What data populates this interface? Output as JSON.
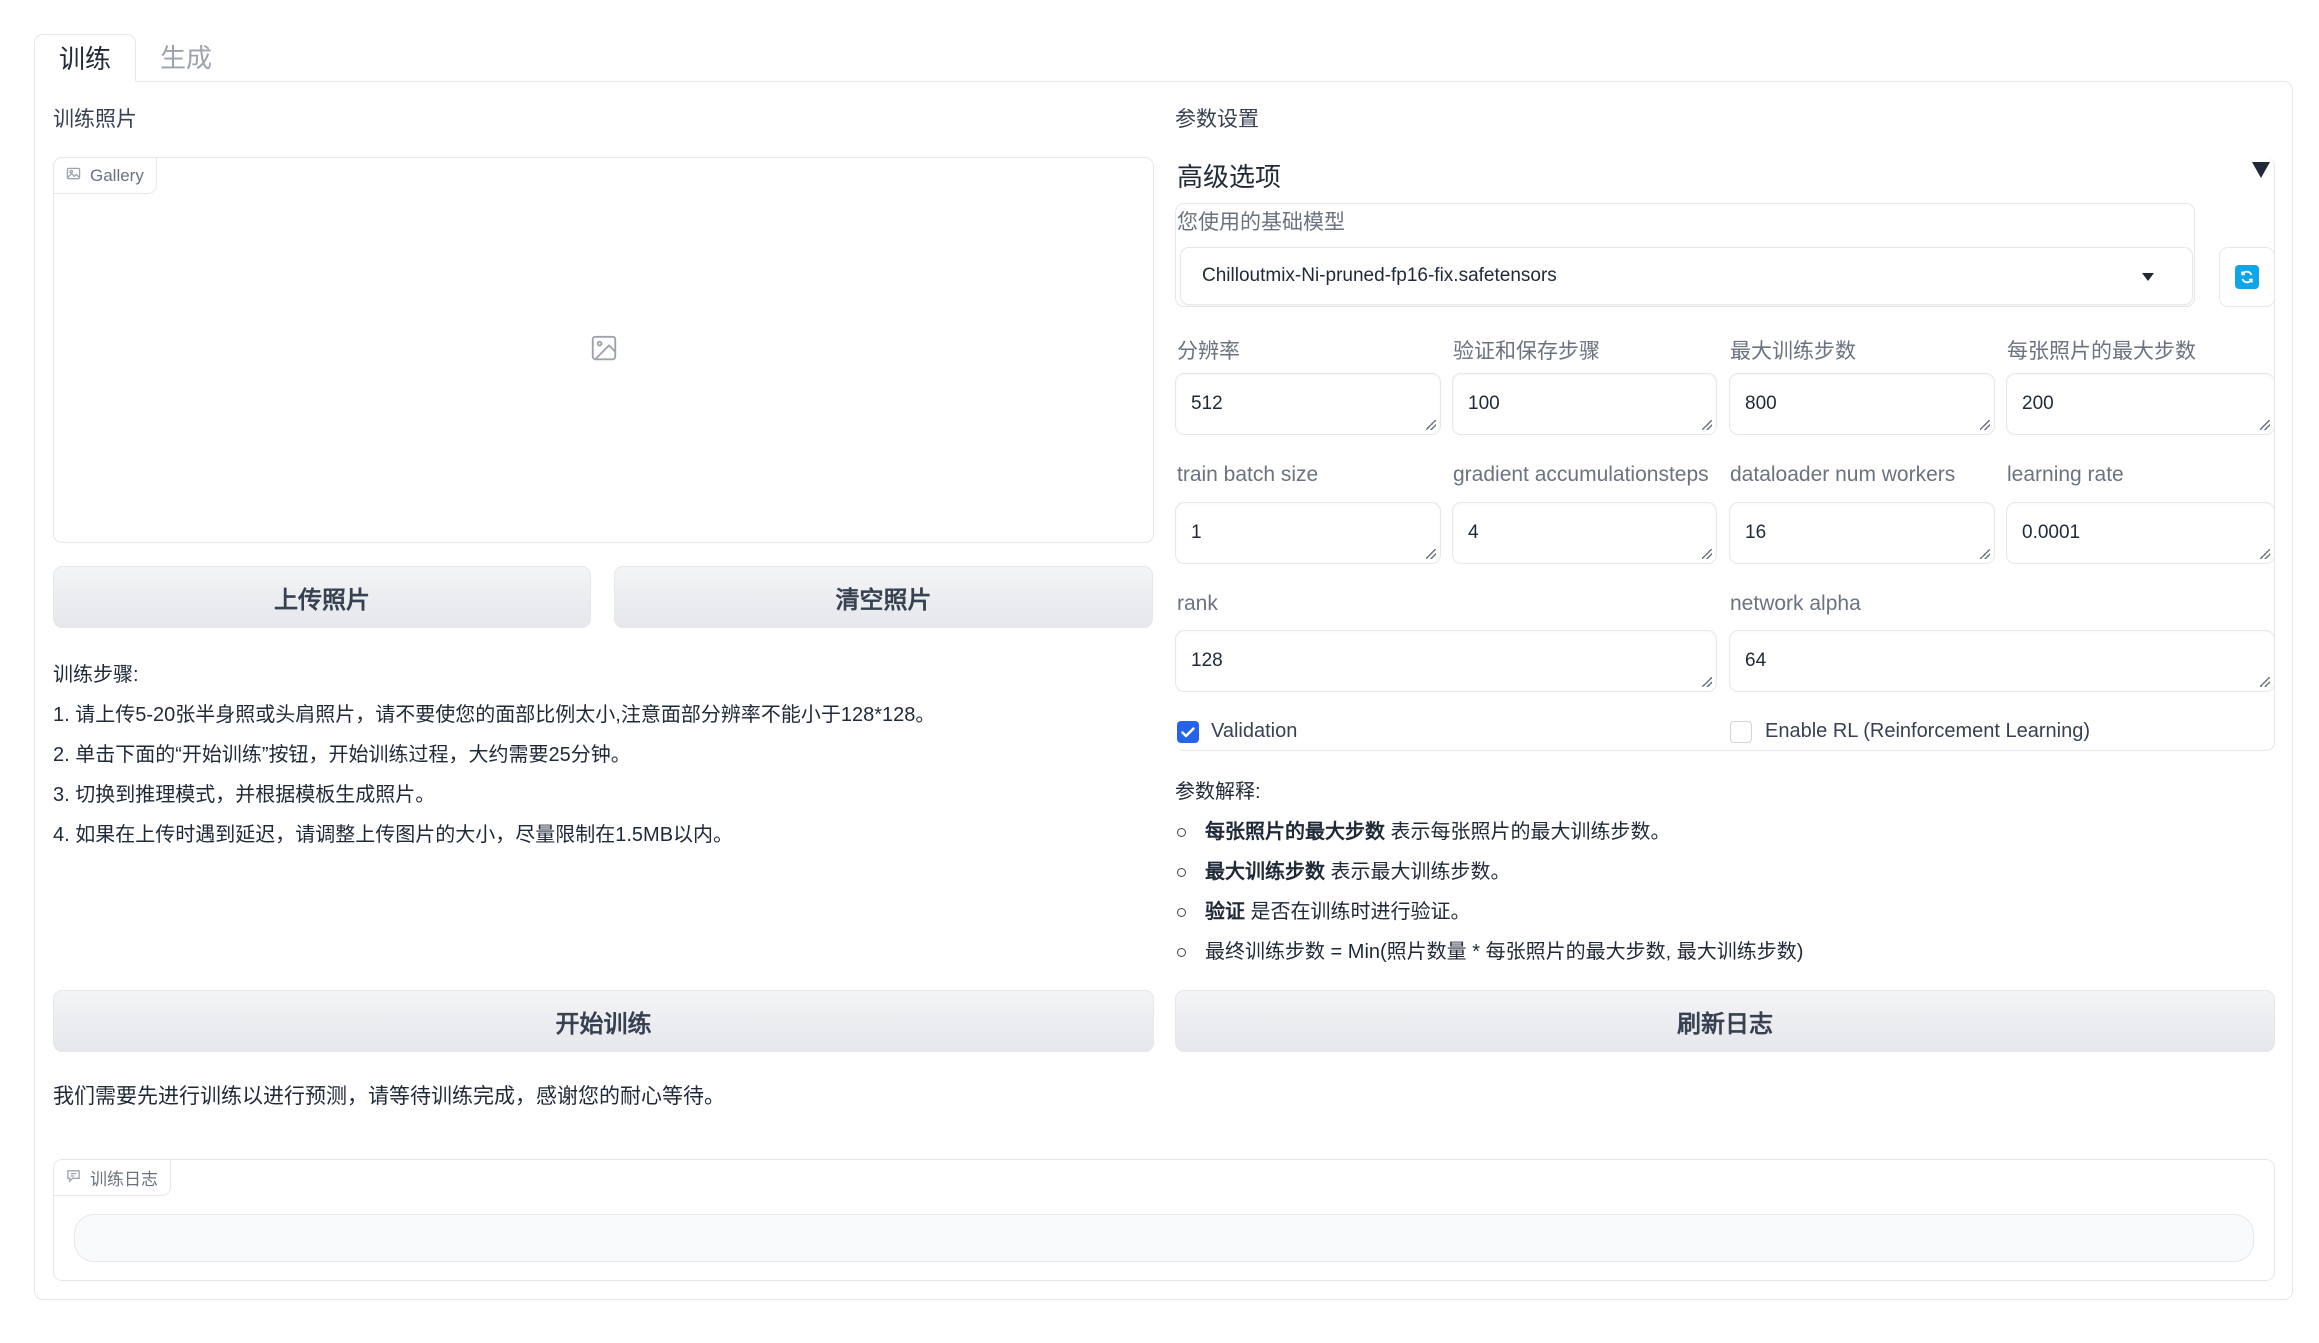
{
  "tabs": [
    {
      "label": "训练",
      "active": true
    },
    {
      "label": "生成",
      "active": false
    }
  ],
  "left": {
    "photos_label": "训练照片",
    "gallery_chip": "Gallery",
    "upload_button": "上传照片",
    "clear_button": "清空照片",
    "steps_title": "训练步骤:",
    "steps": [
      "1. 请上传5-20张半身照或头肩照片，请不要使您的面部比例太小,注意面部分辨率不能小于128*128。",
      "2. 单击下面的“开始训练”按钮，开始训练过程，大约需要25分钟。",
      "3. 切换到推理模式，并根据模板生成照片。",
      "4. 如果在上传时遇到延迟，请调整上传图片的大小，尽量限制在1.5MB以内。"
    ],
    "start_button": "开始训练",
    "wait_text": "我们需要先进行训练以进行预测，请等待训练完成，感谢您的耐心等待。",
    "log_chip": "训练日志",
    "log_value": ""
  },
  "right": {
    "params_label": "参数设置",
    "advanced_title": "高级选项",
    "model_label": "您使用的基础模型",
    "model_value": "Chilloutmix-Ni-pruned-fp16-fix.safetensors",
    "fields_row1": [
      {
        "label": "分辨率",
        "value": "512"
      },
      {
        "label": "验证和保存步骤",
        "value": "100"
      },
      {
        "label": "最大训练步数",
        "value": "800"
      },
      {
        "label": "每张照片的最大步数",
        "value": "200"
      }
    ],
    "fields_row2": [
      {
        "label": "train batch size",
        "value": "1"
      },
      {
        "label": "gradient accumulationsteps",
        "value": "4"
      },
      {
        "label": "dataloader num workers",
        "value": "16"
      },
      {
        "label": "learning rate",
        "value": "0.0001"
      }
    ],
    "fields_row3": [
      {
        "label": "rank",
        "value": "128"
      },
      {
        "label": "network alpha",
        "value": "64"
      }
    ],
    "validation_label": "Validation",
    "validation_checked": true,
    "rl_label": "Enable RL (Reinforcement Learning)",
    "rl_checked": false,
    "explain_title": "参数解释:",
    "explain_items": [
      {
        "bold": "每张照片的最大步数",
        "text": " 表示每张照片的最大训练步数。"
      },
      {
        "bold": "最大训练步数",
        "text": " 表示最大训练步数。"
      },
      {
        "bold": "验证",
        "text": " 是否在训练时进行验证。"
      },
      {
        "bold": "",
        "text": "最终训练步数 = Min(照片数量 * 每张照片的最大步数, 最大训练步数)"
      }
    ],
    "refresh_log_button": "刷新日志"
  },
  "colors": {
    "accent": "#2563eb",
    "refresh_icon": "#0ea5e9",
    "border": "#e5e7eb"
  }
}
